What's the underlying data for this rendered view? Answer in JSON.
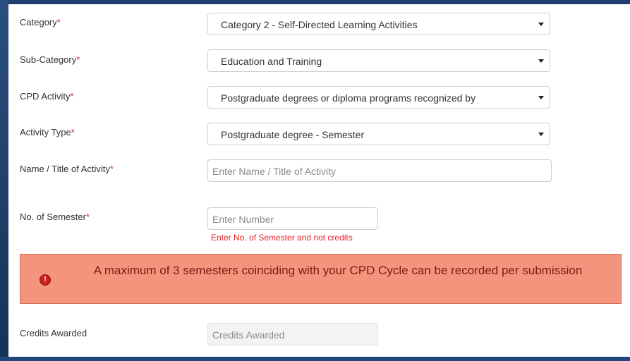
{
  "form": {
    "category": {
      "label": "Category",
      "required": "*",
      "value": "Category 2 - Self-Directed Learning Activities"
    },
    "sub_category": {
      "label": "Sub-Category",
      "required": "*",
      "value": "Education and Training"
    },
    "cpd_activity": {
      "label": "CPD Activity",
      "required": "*",
      "value": "Postgraduate degrees or diploma programs recognized by"
    },
    "activity_type": {
      "label": "Activity Type",
      "required": "*",
      "value": "Postgraduate degree - Semester"
    },
    "name_title": {
      "label": "Name / Title of Activity",
      "required": "*",
      "placeholder": "Enter Name / Title of Activity"
    },
    "semesters": {
      "label": "No. of Semester",
      "required": "*",
      "placeholder": "Enter Number",
      "hint": "Enter No. of Semester and not credits"
    },
    "credits": {
      "label": "Credits Awarded",
      "placeholder": "Credits Awarded"
    }
  },
  "alert": {
    "icon": "exclamation-circle-icon",
    "message": "A maximum of 3 semesters coinciding with your CPD Cycle can be recorded per submission"
  },
  "colors": {
    "alert_bg": "#f3957d",
    "required": "#d9262c",
    "hint": "#e3222a"
  }
}
